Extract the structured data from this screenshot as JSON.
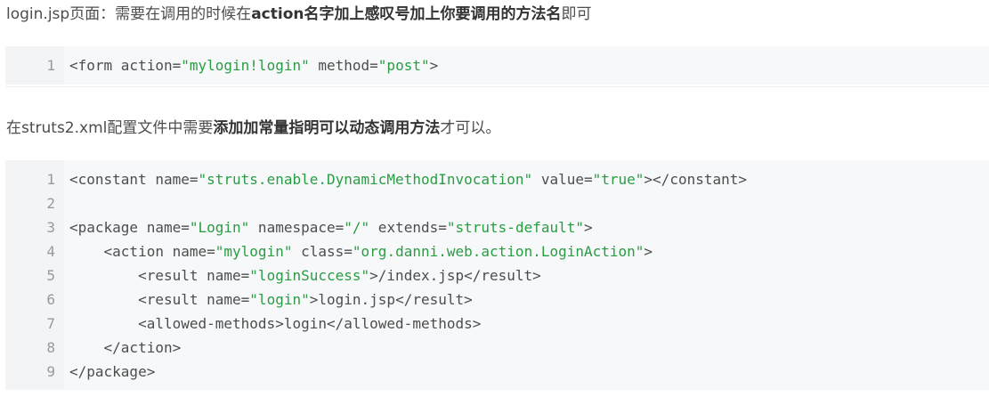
{
  "para1": {
    "pre": "login.jsp页面：需要在调用的时候在",
    "bold": "action名字加上感叹号加上你要调用的方法名",
    "post": "即可"
  },
  "code1": {
    "lines": [
      {
        "num": "1",
        "parts": [
          {
            "t": "<form action=",
            "c": "plain"
          },
          {
            "t": "\"mylogin!login\"",
            "c": "str"
          },
          {
            "t": " method=",
            "c": "plain"
          },
          {
            "t": "\"post\"",
            "c": "str"
          },
          {
            "t": ">",
            "c": "plain"
          }
        ]
      }
    ]
  },
  "para2": {
    "pre": "在struts2.xml配置文件中需要",
    "bold": "添加加常量指明可以动态调用方法",
    "post": "才可以。"
  },
  "code2": {
    "lines": [
      {
        "num": "1",
        "parts": [
          {
            "t": "<constant name=",
            "c": "plain"
          },
          {
            "t": "\"struts.enable.DynamicMethodInvocation\"",
            "c": "str"
          },
          {
            "t": " value=",
            "c": "plain"
          },
          {
            "t": "\"true\"",
            "c": "str"
          },
          {
            "t": "></constant>",
            "c": "plain"
          }
        ]
      },
      {
        "num": "2",
        "parts": []
      },
      {
        "num": "3",
        "parts": [
          {
            "t": "<package name=",
            "c": "plain"
          },
          {
            "t": "\"Login\"",
            "c": "str"
          },
          {
            "t": " namespace=",
            "c": "plain"
          },
          {
            "t": "\"/\"",
            "c": "str"
          },
          {
            "t": " extends=",
            "c": "plain"
          },
          {
            "t": "\"struts-default\"",
            "c": "str"
          },
          {
            "t": ">",
            "c": "plain"
          }
        ]
      },
      {
        "num": "4",
        "parts": [
          {
            "t": "    <action name=",
            "c": "plain"
          },
          {
            "t": "\"mylogin\"",
            "c": "str"
          },
          {
            "t": " class=",
            "c": "plain"
          },
          {
            "t": "\"org.danni.web.action.LoginAction\"",
            "c": "str"
          },
          {
            "t": ">",
            "c": "plain"
          }
        ]
      },
      {
        "num": "5",
        "parts": [
          {
            "t": "        <result name=",
            "c": "plain"
          },
          {
            "t": "\"loginSuccess\"",
            "c": "str"
          },
          {
            "t": ">/index.jsp</result>",
            "c": "plain"
          }
        ]
      },
      {
        "num": "6",
        "parts": [
          {
            "t": "        <result name=",
            "c": "plain"
          },
          {
            "t": "\"login\"",
            "c": "str"
          },
          {
            "t": ">login.jsp</result>",
            "c": "plain"
          }
        ]
      },
      {
        "num": "7",
        "parts": [
          {
            "t": "        <allowed-methods>login</allowed-methods>",
            "c": "plain"
          }
        ]
      },
      {
        "num": "8",
        "parts": [
          {
            "t": "    </action>",
            "c": "plain"
          }
        ]
      },
      {
        "num": "9",
        "parts": [
          {
            "t": "</package>",
            "c": "plain"
          }
        ]
      }
    ]
  }
}
